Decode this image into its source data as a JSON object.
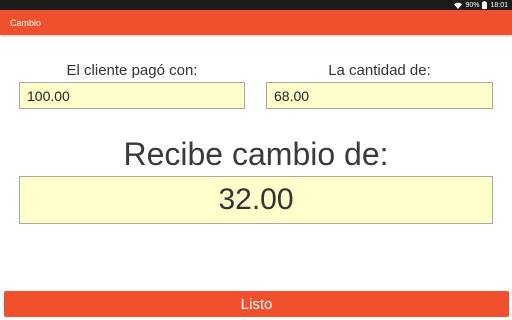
{
  "status_bar": {
    "battery": "90%",
    "time": "18:01"
  },
  "app_bar": {
    "title": "Cambio"
  },
  "paid_field": {
    "label": "El cliente pagó con:",
    "value": "100.00"
  },
  "amount_field": {
    "label": "La cantidad de:",
    "value": "68.00"
  },
  "change": {
    "label": "Recibe cambio de:",
    "value": "32.00"
  },
  "done_button": {
    "label": "Listo"
  },
  "colors": {
    "accent": "#f0502d",
    "input_bg": "#ffffcc"
  },
  "icons": [
    "wifi-icon",
    "battery-icon"
  ]
}
